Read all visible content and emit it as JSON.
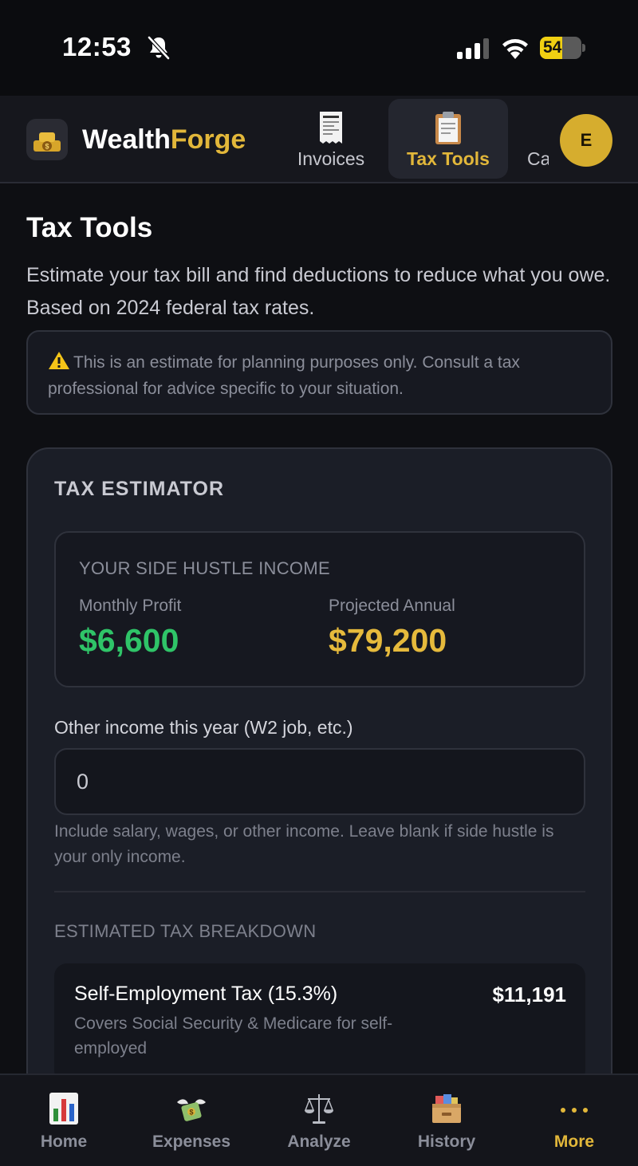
{
  "status_bar": {
    "time": "12:53",
    "battery": "54",
    "battery_level": 0.54
  },
  "header": {
    "brand_main": "Wealth",
    "brand_accent": "Forge",
    "tabs": [
      {
        "label": "Invoices",
        "icon": "receipt-icon",
        "active": false
      },
      {
        "label": "Tax Tools",
        "icon": "clipboard-icon",
        "active": true
      },
      {
        "label": "Ca",
        "icon": "",
        "active": false
      }
    ],
    "avatar_initial": "E"
  },
  "page": {
    "title": "Tax Tools",
    "description": "Estimate your tax bill and find deductions to reduce what you owe. Based on 2024 federal tax rates.",
    "warning": "This is an estimate for planning purposes only. Consult a tax professional for advice specific to your situation."
  },
  "estimator": {
    "title": "TAX ESTIMATOR",
    "income": {
      "header": "YOUR SIDE HUSTLE INCOME",
      "monthly_label": "Monthly Profit",
      "monthly_value": "$6,600",
      "annual_label": "Projected Annual",
      "annual_value": "$79,200"
    },
    "other_income": {
      "label": "Other income this year (W2 job, etc.)",
      "value": "0",
      "help": "Include salary, wages, or other income. Leave blank if side hustle is your only income."
    },
    "breakdown": {
      "header": "ESTIMATED TAX BREAKDOWN",
      "rows": [
        {
          "title": "Self-Employment Tax (15.3%)",
          "amount": "$11,191",
          "description": "Covers Social Security & Medicare for self-employed"
        }
      ]
    }
  },
  "bottom_nav": [
    {
      "label": "Home",
      "icon": "bar-chart-icon",
      "active": false
    },
    {
      "label": "Expenses",
      "icon": "money-wings-icon",
      "active": false
    },
    {
      "label": "Analyze",
      "icon": "scales-icon",
      "active": false
    },
    {
      "label": "History",
      "icon": "card-file-box-icon",
      "active": false
    },
    {
      "label": "More",
      "icon": "more-dots-icon",
      "active": true
    }
  ],
  "colors": {
    "accent": "#e2b73a",
    "positive": "#2fc468",
    "background": "#0e0f13",
    "card": "#1b1e27"
  }
}
